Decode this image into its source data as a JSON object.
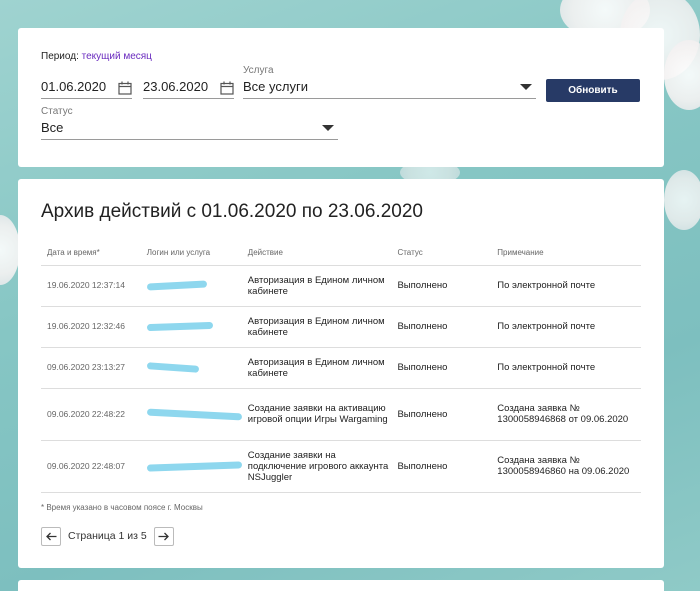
{
  "filter": {
    "period_label": "Период:",
    "period_value": "текущий месяц",
    "date_from": "01.06.2020",
    "date_to": "23.06.2020",
    "service_label": "Услуга",
    "service_value": "Все услуги",
    "status_label": "Статус",
    "status_value": "Все",
    "update_button": "Обновить"
  },
  "archive": {
    "title": "Архив действий с 01.06.2020 по 23.06.2020",
    "columns": [
      "Дата и время*",
      "Логин или услуга",
      "Действие",
      "Статус",
      "Примечание"
    ],
    "rows": [
      {
        "datetime": "19.06.2020 12:37:14",
        "action": "Авторизация в Едином личном кабинете",
        "status": "Выполнено",
        "note": "По электронной почте"
      },
      {
        "datetime": "19.06.2020 12:32:46",
        "action": "Авторизация в Едином личном кабинете",
        "status": "Выполнено",
        "note": "По электронной почте"
      },
      {
        "datetime": "09.06.2020 23:13:27",
        "action": "Авторизация в Едином личном кабинете",
        "status": "Выполнено",
        "note": "По электронной почте"
      },
      {
        "datetime": "09.06.2020 22:48:22",
        "action": "Создание заявки на активацию игровой опции Игры Wargaming",
        "status": "Выполнено",
        "note": "Создана заявка № 1300058946868 от 09.06.2020"
      },
      {
        "datetime": "09.06.2020 22:48:07",
        "action": "Создание заявки на подключение игрового аккаунта NSJuggler",
        "status": "Выполнено",
        "note": "Создана заявка № 1300058946860 на 09.06.2020"
      }
    ],
    "footnote": "* Время указано в часовом поясе г. Москвы",
    "pagination": "Страница 1 из 5"
  },
  "icons": {
    "calendar": "calendar-icon",
    "dropdown": "chevron-down-icon",
    "prev": "arrow-left-icon",
    "next": "arrow-right-icon"
  },
  "colors": {
    "accent_link": "#6a2bbf",
    "button_bg": "#273a66",
    "redaction": "#8ed7ee"
  }
}
